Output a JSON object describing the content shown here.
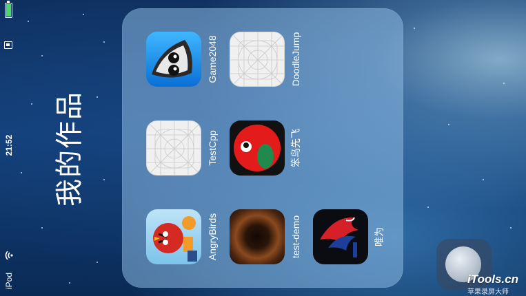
{
  "status_bar": {
    "time": "21:52",
    "carrier": "iPod",
    "battery_level": 1.0,
    "battery_icon": "battery-icon",
    "lock_icon": "rotation-lock-icon",
    "wifi_icon": "wifi-icon"
  },
  "folder": {
    "title": "我的作品",
    "apps": [
      {
        "label": "Game2048",
        "icon": "game2048-icon"
      },
      {
        "label": "DoodleJump",
        "icon": "placeholder-grid-icon"
      },
      {
        "label": "TestCpp",
        "icon": "placeholder-grid-icon"
      },
      {
        "label": "笨鸟先飞",
        "icon": "red-bird-icon"
      },
      {
        "label": "AngryBirds",
        "icon": "angry-birds-icon"
      },
      {
        "label": "test-demo",
        "icon": "brown-swirl-icon"
      },
      {
        "label": "唯为",
        "icon": "eagle-logo-icon"
      }
    ]
  },
  "watermark": {
    "main": "iTools.cn",
    "sub": "苹果录屏大师"
  },
  "colors": {
    "battery": "#4cd964",
    "folder_bg": "#8cb9e1"
  }
}
